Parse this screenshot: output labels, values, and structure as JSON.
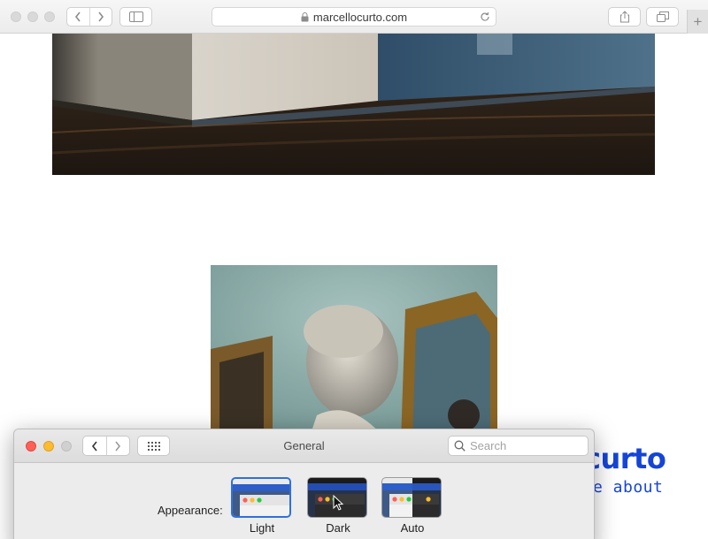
{
  "browser": {
    "url": "marcellocurto.com",
    "icons": [
      "back-chevron-icon",
      "forward-chevron-icon",
      "sidebar-icon",
      "lock-icon",
      "reload-icon",
      "share-icon",
      "tabs-icon",
      "plus-icon"
    ],
    "new_tab_label": "+"
  },
  "page": {
    "brand_partial": "curto",
    "brand_sub_partial": "e about",
    "brand_color": "#1545d6"
  },
  "preferences": {
    "title": "General",
    "search_placeholder": "Search",
    "appearance_label": "Appearance:",
    "appearance_options": [
      {
        "label": "Light",
        "selected": true
      },
      {
        "label": "Dark",
        "selected": false
      },
      {
        "label": "Auto",
        "selected": false
      }
    ],
    "selection_color": "#2f6fe0",
    "traffic_colors": [
      "#fe5f57",
      "#febb2e",
      "#d0d0d0"
    ]
  }
}
